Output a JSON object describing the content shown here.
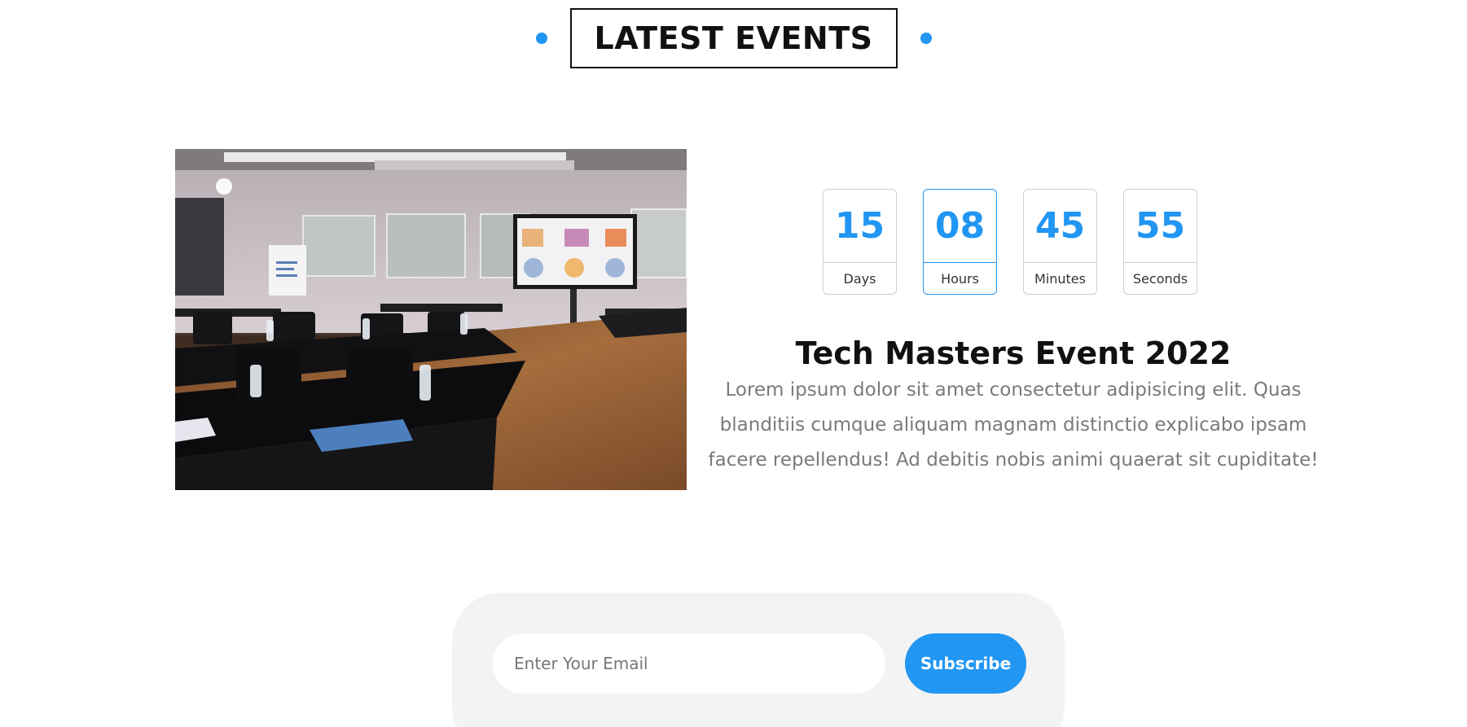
{
  "section": {
    "title": "LATEST EVENTS",
    "accent_color": "#2196f3"
  },
  "event": {
    "image_alt": "conference room with desks, water bottles and a presentation screen",
    "title": "Tech Masters Event 2022",
    "description": "Lorem ipsum dolor sit amet consectetur adipisicing elit. Quas blanditiis cumque aliquam magnam distinctio explicabo ipsam facere repellendus! Ad debitis nobis animi quaerat sit cupiditate!"
  },
  "countdown": [
    {
      "value": "15",
      "label": "Days"
    },
    {
      "value": "08",
      "label": "Hours"
    },
    {
      "value": "45",
      "label": "Minutes"
    },
    {
      "value": "55",
      "label": "Seconds"
    }
  ],
  "subscribe": {
    "placeholder": "Enter Your Email",
    "button_label": "Subscribe"
  }
}
